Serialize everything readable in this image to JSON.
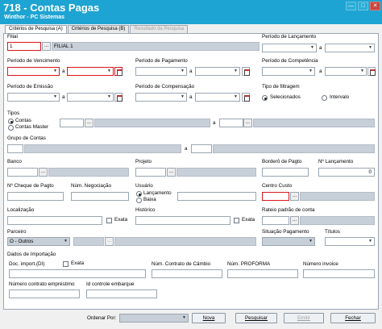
{
  "window": {
    "title": "718 - Contas Pagas",
    "subtitle": "Winthor - PC Sistemas",
    "minimize": "—",
    "maximize": "□",
    "close": "✕"
  },
  "tabs": [
    {
      "label": "Critérios de Pesquisa (A)"
    },
    {
      "label": "Critérios de Pesquisa (B)"
    },
    {
      "label": "Resultado da Pesquisa"
    }
  ],
  "form": {
    "filial_label": "Filial",
    "filial_code": "1",
    "filial_name": "FILIAL 1",
    "periodo_lancamento_label": "Período de Lançamento",
    "periodo_vencimento_label": "Período de Vencimento",
    "periodo_pagamento_label": "Período de Pagamento",
    "periodo_competencia_label": "Período de Competência",
    "periodo_emissao_label": "Período de Emissão",
    "periodo_compensacao_label": "Período de Compensação",
    "tipo_filtragem_label": "Tipo de filtragem",
    "tipo_filtragem_opt1": "Selecionados",
    "tipo_filtragem_opt2": "Intervalo",
    "a": "a",
    "tipos_label": "Tipos",
    "tipos_opt1": "Contas",
    "tipos_opt2": "Contas Master",
    "grupo_contas_label": "Grupo de Contas",
    "banco_label": "Banco",
    "projeto_label": "Projeto",
    "bordero_label": "Borderô de Pagto",
    "num_lancamento_label": "Nº Lançamento",
    "num_lancamento_value": "0",
    "num_cheque_label": "Nº Cheque de Pagto",
    "num_negociacao_label": "Núm. Negociação",
    "usuario_label": "Usuário",
    "usuario_opt1": "Lançamento",
    "usuario_opt2": "Baixa",
    "centro_custo_label": "Centro Custo",
    "localizacao_label": "Localização",
    "exata_label": "Exata",
    "historico_label": "Histórico",
    "rateio_label": "Rateio padrão de conta",
    "parceiro_label": "Parceiro",
    "parceiro_value": "O - Outros",
    "situacao_label": "Situação Pagamento",
    "titulos_label": "Títulos",
    "dados_importacao_label": "Dados de Importação",
    "doc_import_label": "Doc. import.(DI)",
    "num_contrato_cambio_label": "Núm. Contrato de Câmbio",
    "num_proforma_label": "Núm. PROFORMA",
    "num_invoice_label": "Número invoice",
    "num_contrato_emprestimo_label": "Número contrato empréstimo",
    "id_controle_label": "Id controle embarque",
    "dots": "...",
    "dropdown_arrow": "▼"
  },
  "bottom": {
    "ordenar_label": "Ordenar Por:",
    "nova": "Nova",
    "pesquisar": "Pesquisar",
    "emitir": "Emitir",
    "fechar": "Fechar"
  }
}
